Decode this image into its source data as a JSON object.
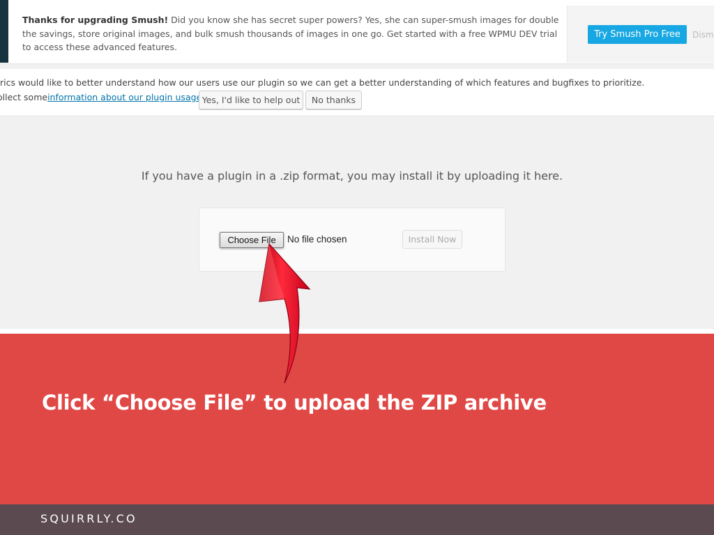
{
  "smush_notice": {
    "bold_text": "Thanks for upgrading Smush!",
    "body_text": " Did you know she has secret super powers? Yes, she can super-smush images for double the savings, store original images, and bulk smush thousands of images in one go. Get started with a free WPMU DEV trial to access these advanced features.",
    "try_button": "Try Smush Pro Free",
    "dismiss_link": "Dism"
  },
  "tracking_notice": {
    "line1": "rics would like to better understand how our users use our plugin so we can get a better understanding of which features and bugfixes to prioritize.",
    "line2_prefix": "ollect some ",
    "link_text": "information about our plugin usage?",
    "yes_button": "Yes, I'd like to help out",
    "no_button": "No thanks"
  },
  "upload": {
    "message": "If you have a plugin in a .zip format, you may install it by uploading it here.",
    "choose_file": "Choose File",
    "no_file": "No file chosen",
    "install_button": "Install Now"
  },
  "banner": {
    "caption": "Click “Choose File” to upload the ZIP archive",
    "brand": "SQUIRRLY.CO"
  },
  "colors": {
    "banner_red": "#e04846",
    "footer": "#5c4a51",
    "smush_blue": "#17a8e3",
    "smush_dark": "#17333f",
    "arrow_red": "#e8192c"
  }
}
